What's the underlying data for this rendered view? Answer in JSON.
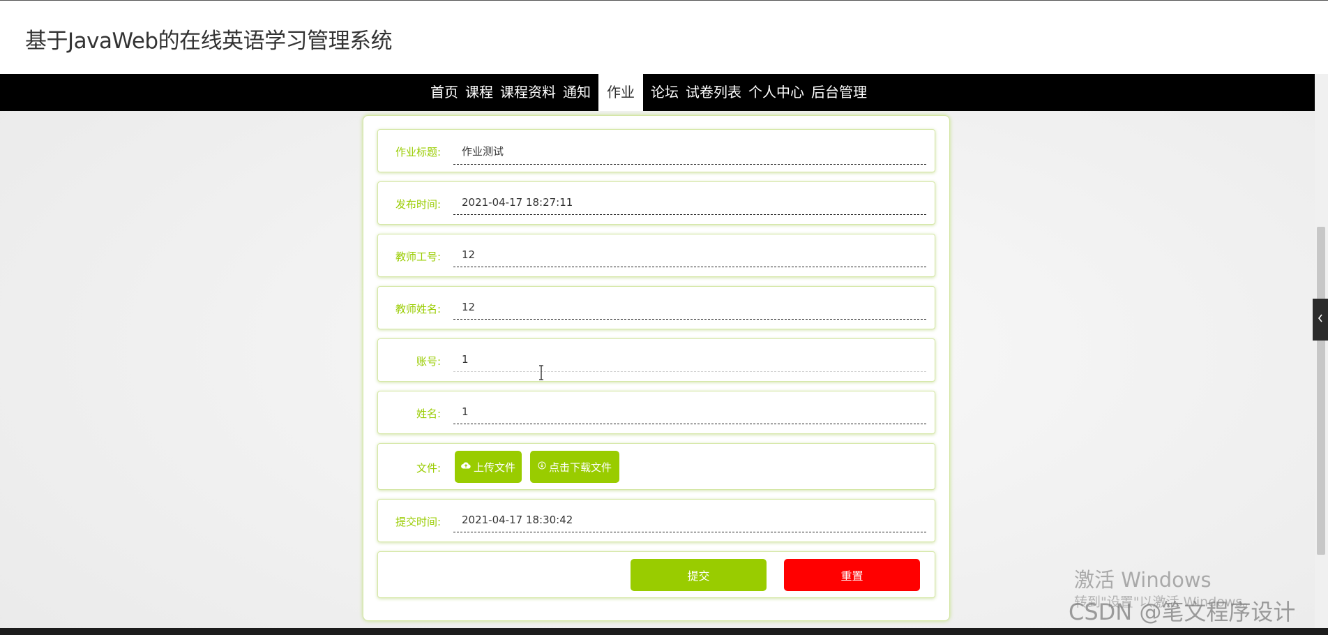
{
  "header": {
    "title": "基于JavaWeb的在线英语学习管理系统"
  },
  "nav": {
    "items": [
      {
        "label": "首页"
      },
      {
        "label": "课程"
      },
      {
        "label": "课程资料"
      },
      {
        "label": "通知"
      },
      {
        "label": "作业"
      },
      {
        "label": "论坛"
      },
      {
        "label": "试卷列表"
      },
      {
        "label": "个人中心"
      },
      {
        "label": "后台管理"
      }
    ],
    "active": "作业"
  },
  "form": {
    "fields": [
      {
        "label": "作业标题:",
        "value": "作业测试"
      },
      {
        "label": "发布时间:",
        "value": "2021-04-17 18:27:11"
      },
      {
        "label": "教师工号:",
        "value": "12"
      },
      {
        "label": "教师姓名:",
        "value": "12"
      },
      {
        "label": "账号:",
        "value": "1"
      },
      {
        "label": "姓名:",
        "value": "1"
      }
    ],
    "file": {
      "label": "文件:",
      "upload_label": "上传文件",
      "download_label": "点击下载文件"
    },
    "submit_time": {
      "label": "提交时间:",
      "value": "2021-04-17 18:30:42"
    },
    "buttons": {
      "submit": "提交",
      "reset": "重置"
    }
  },
  "overlay": {
    "watermark_title": "激活 Windows",
    "watermark_sub": "转到\"设置\"以激活 Windows。",
    "csdn": "CSDN @笔文程序设计"
  },
  "side_tab": {
    "icon": "chevron-left-icon"
  },
  "colors": {
    "accent": "#99cc00",
    "reset": "#ff0000",
    "navbar": "#000000"
  }
}
